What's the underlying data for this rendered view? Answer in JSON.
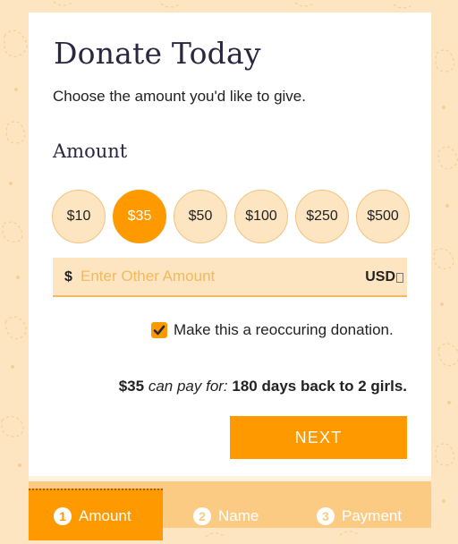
{
  "form": {
    "title": "Donate Today",
    "subtitle": "Choose the amount you'd like to give.",
    "amount_heading": "Amount",
    "amounts": [
      "$10",
      "$35",
      "$50",
      "$100",
      "$250",
      "$500"
    ],
    "selected_amount": "$35",
    "other_amount": {
      "currency_sign": "$",
      "placeholder": "Enter Other Amount",
      "value": "",
      "currency_code": "USD"
    },
    "recurring": {
      "checked": true,
      "label": "Make this a reoccuring donation."
    },
    "impact": {
      "amount": "$35",
      "prefix": "can pay for:",
      "text": "180 days back to 2 girls."
    },
    "next_label": "NEXT"
  },
  "steps": [
    {
      "number": "1",
      "label": "Amount",
      "active": true
    },
    {
      "number": "2",
      "label": "Name",
      "active": false
    },
    {
      "number": "3",
      "label": "Payment",
      "active": false
    }
  ],
  "colors": {
    "accent": "#fe9900",
    "background": "#fde5c1",
    "step_bar": "#fccb83",
    "text_dark": "#2a2741"
  }
}
